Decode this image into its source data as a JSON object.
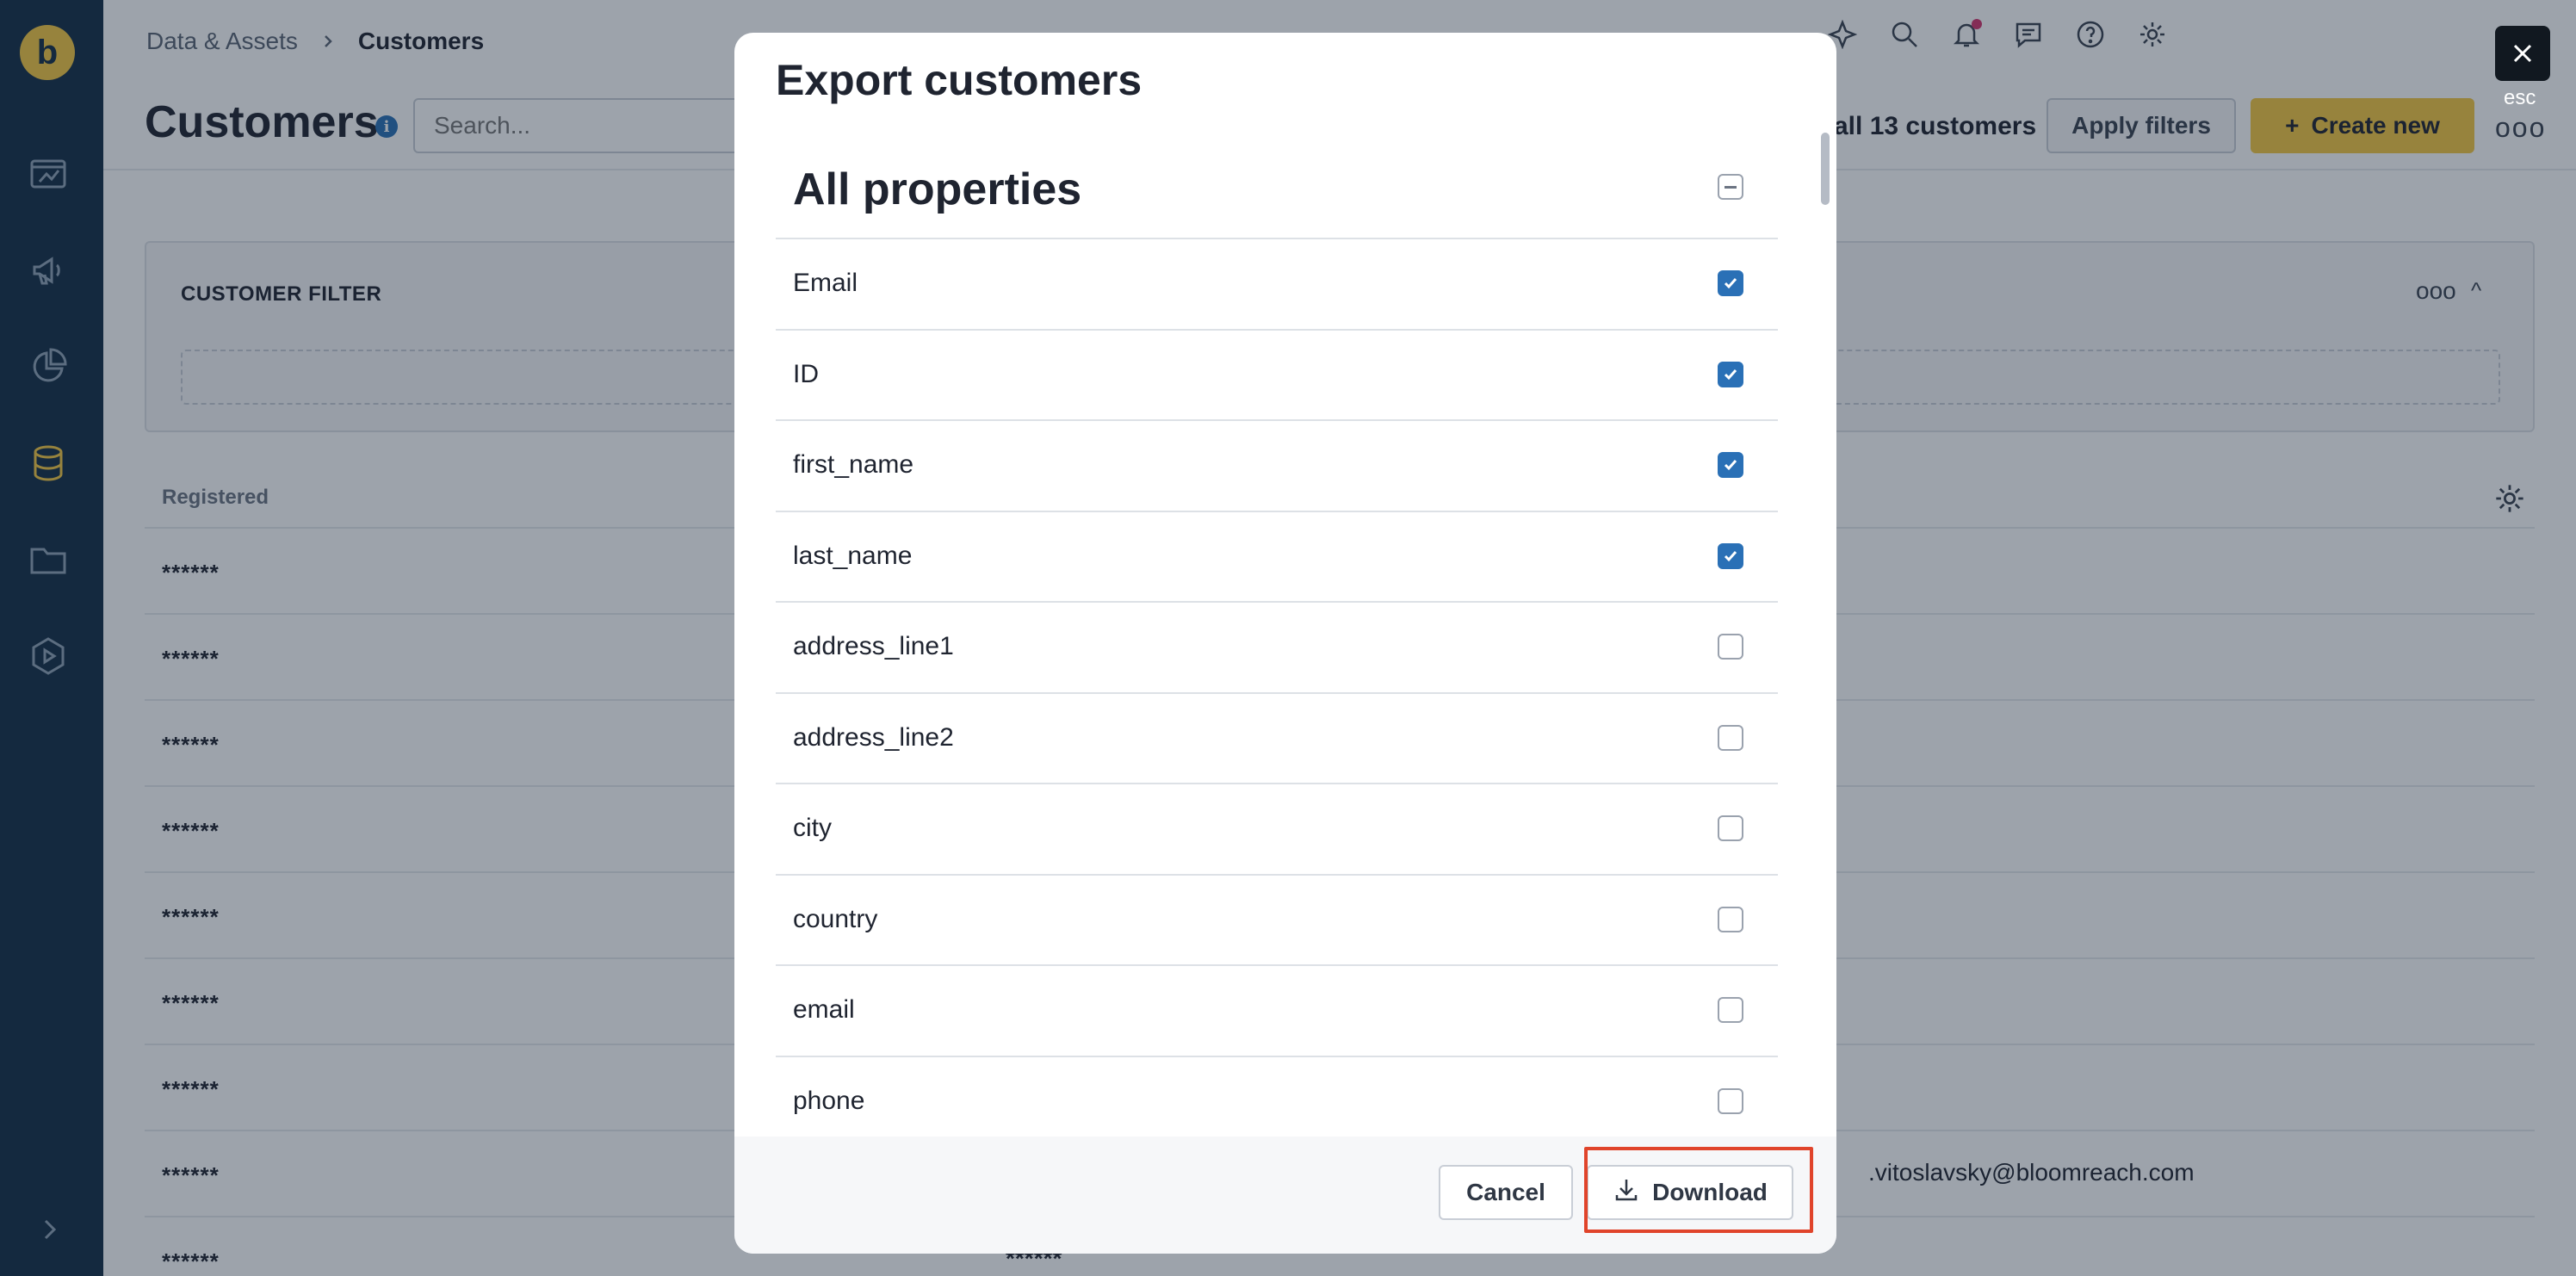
{
  "sidebar": {
    "logo_letter": "b",
    "items": [
      {
        "icon": "dashboard-icon"
      },
      {
        "icon": "megaphone-icon"
      },
      {
        "icon": "pie-chart-icon"
      },
      {
        "icon": "database-icon"
      },
      {
        "icon": "folder-icon"
      },
      {
        "icon": "play-icon"
      }
    ],
    "expand_icon": "chevron-right-icon"
  },
  "header": {
    "breadcrumb": [
      "Data & Assets",
      "Customers"
    ],
    "title": "Customers",
    "search_placeholder": "Search...",
    "count_text": "all 13 customers",
    "apply_label": "Apply filters",
    "create_label": "Create new",
    "more_label": "ooo"
  },
  "filter": {
    "title": "CUSTOMER FILTER",
    "more_label": "ooo",
    "collapse_label": "^"
  },
  "table": {
    "col_registered": "Registered",
    "rows": [
      {
        "registered": "******",
        "value": ""
      },
      {
        "registered": "******",
        "value": ""
      },
      {
        "registered": "******",
        "value": ""
      },
      {
        "registered": "******",
        "value": ""
      },
      {
        "registered": "******",
        "value": ""
      },
      {
        "registered": "******",
        "value": ""
      },
      {
        "registered": "******",
        "value": ""
      },
      {
        "registered": "******",
        "value": ".vitoslavsky@bloomreach.com"
      },
      {
        "registered": "******",
        "value": "******"
      }
    ]
  },
  "modal": {
    "title": "Export customers",
    "all_label": "All properties",
    "all_state": "mixed",
    "properties": [
      {
        "name": "Email",
        "checked": true
      },
      {
        "name": "ID",
        "checked": true
      },
      {
        "name": "first_name",
        "checked": true
      },
      {
        "name": "last_name",
        "checked": true
      },
      {
        "name": "address_line1",
        "checked": false
      },
      {
        "name": "address_line2",
        "checked": false
      },
      {
        "name": "city",
        "checked": false
      },
      {
        "name": "country",
        "checked": false
      },
      {
        "name": "email",
        "checked": false
      },
      {
        "name": "phone",
        "checked": false
      }
    ],
    "cancel_label": "Cancel",
    "download_label": "Download",
    "esc_label": "esc"
  },
  "colors": {
    "sidebar": "#132e45",
    "accent": "#f5c842",
    "checkbox": "#2a70b6",
    "highlight": "#e0442b"
  }
}
